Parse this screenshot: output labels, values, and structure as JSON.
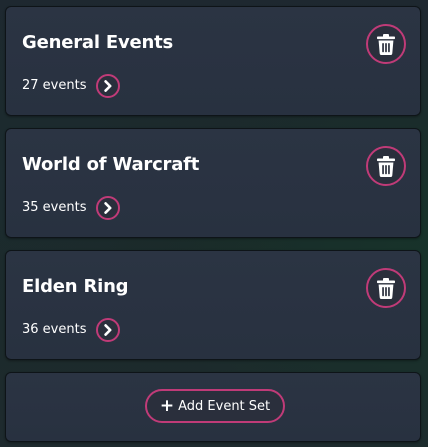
{
  "event_sets": [
    {
      "title": "General Events",
      "count": "27 events"
    },
    {
      "title": "World of Warcraft",
      "count": "35 events"
    },
    {
      "title": "Elden Ring",
      "count": "36 events"
    }
  ],
  "add_button": {
    "icon": "+",
    "label": "Add Event Set"
  },
  "icons": {
    "delete": "trash-icon",
    "open": "chevron-right-icon"
  },
  "colors": {
    "accent": "#c03b78",
    "card": "#2a3342",
    "text": "#ffffff"
  }
}
